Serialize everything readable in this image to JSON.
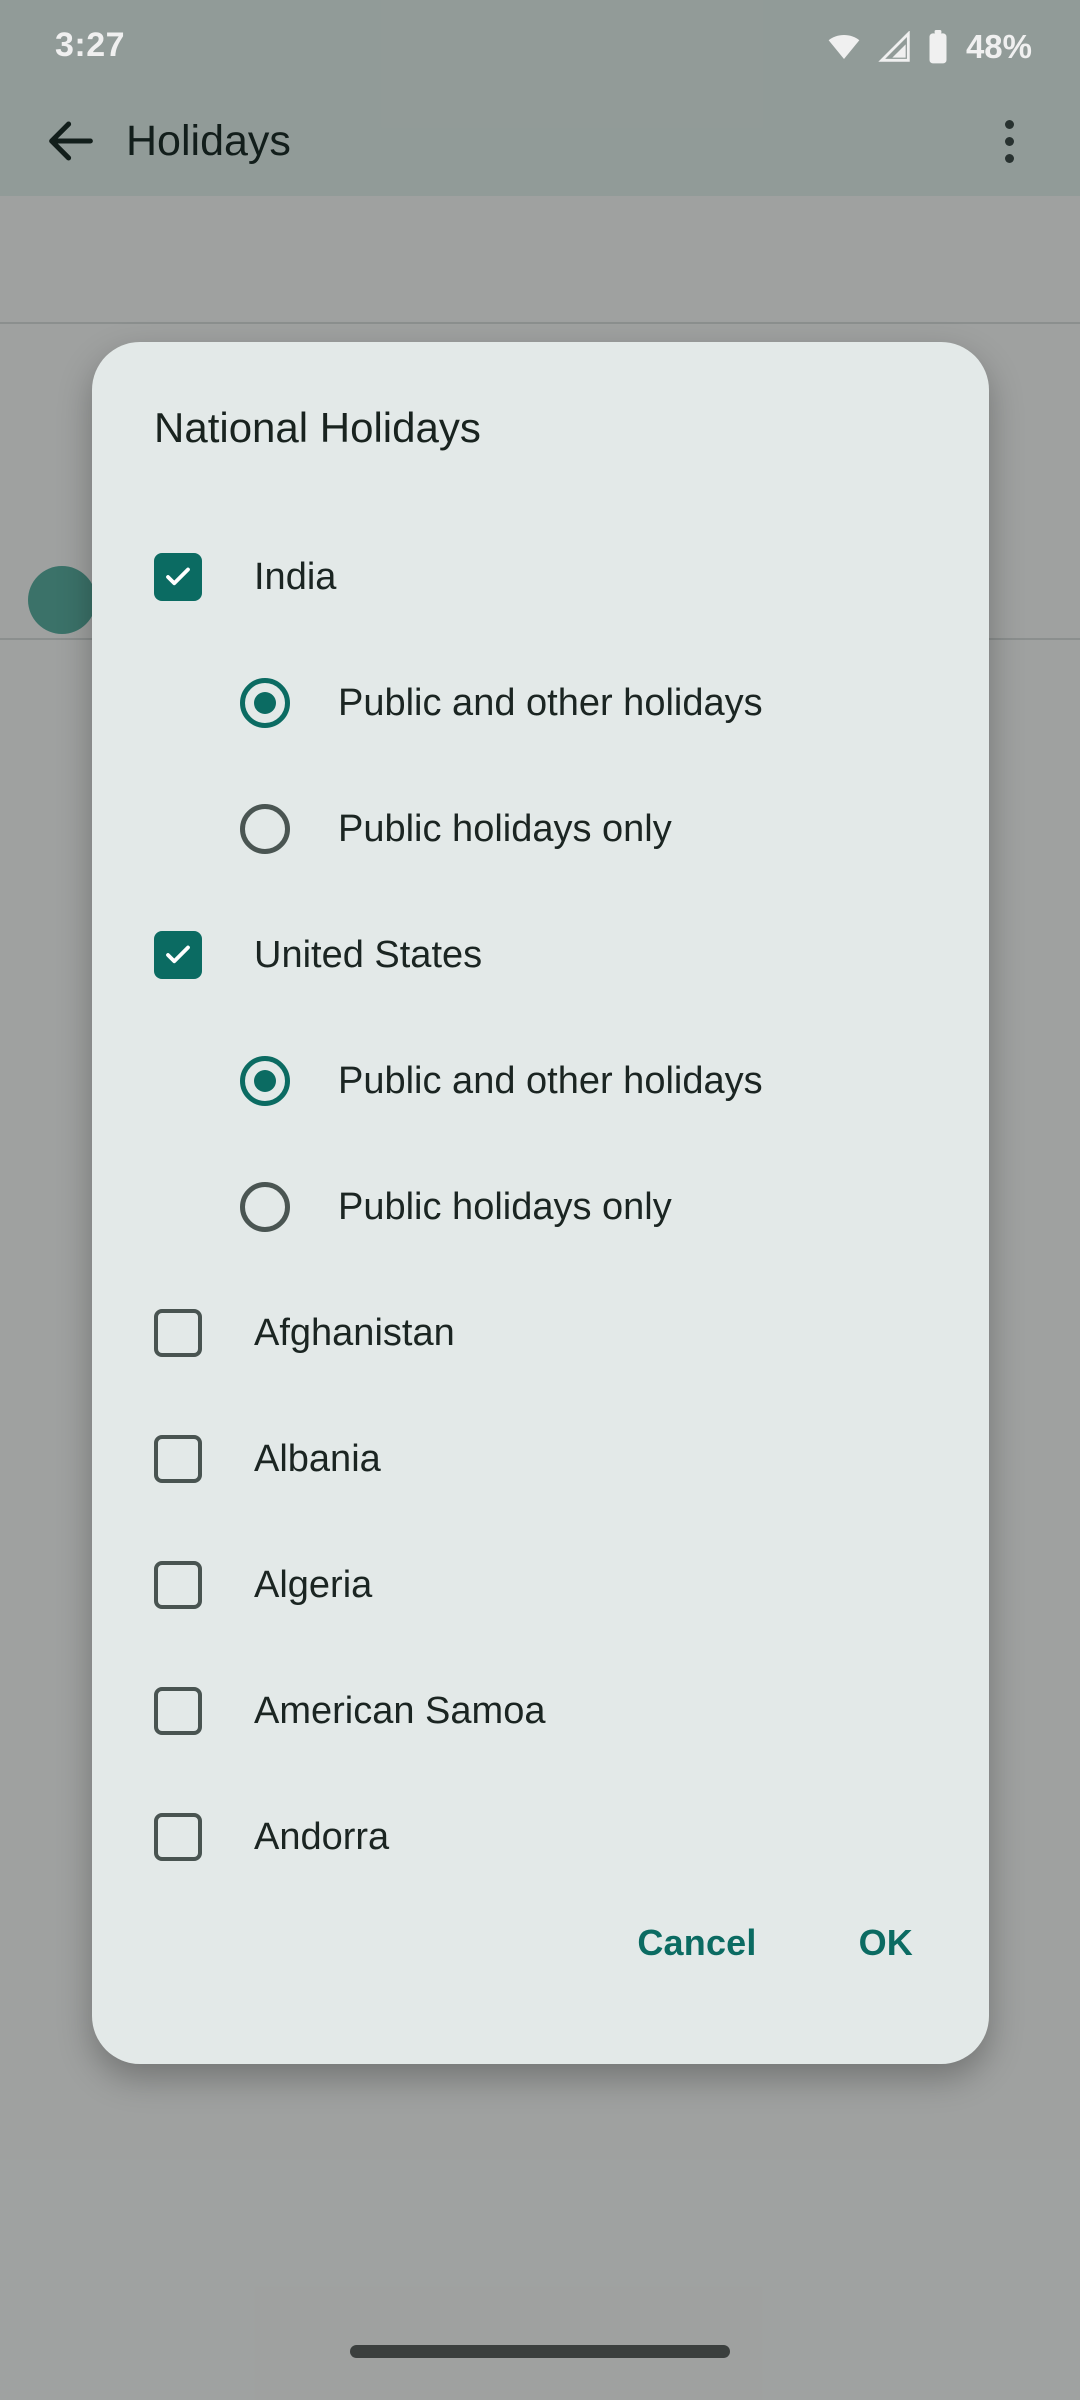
{
  "status_bar": {
    "time": "3:27",
    "battery_percent": "48%",
    "icons": [
      "wifi-icon",
      "cell-signal-icon",
      "battery-icon"
    ]
  },
  "app_bar": {
    "back_icon": "back-arrow-icon",
    "title": "Holidays",
    "overflow_icon": "overflow-menu-icon"
  },
  "dialog": {
    "title": "National Holidays",
    "rows": [
      {
        "kind": "checkbox",
        "label": "India",
        "checked": true
      },
      {
        "kind": "radio",
        "label": "Public and other holidays",
        "selected": true
      },
      {
        "kind": "radio",
        "label": "Public holidays only",
        "selected": false
      },
      {
        "kind": "checkbox",
        "label": "United States",
        "checked": true
      },
      {
        "kind": "radio",
        "label": "Public and other holidays",
        "selected": true
      },
      {
        "kind": "radio",
        "label": "Public holidays only",
        "selected": false
      },
      {
        "kind": "checkbox",
        "label": "Afghanistan",
        "checked": false
      },
      {
        "kind": "checkbox",
        "label": "Albania",
        "checked": false
      },
      {
        "kind": "checkbox",
        "label": "Algeria",
        "checked": false
      },
      {
        "kind": "checkbox",
        "label": "American Samoa",
        "checked": false
      },
      {
        "kind": "checkbox",
        "label": "Andorra",
        "checked": false
      }
    ],
    "cancel_label": "Cancel",
    "ok_label": "OK"
  },
  "colors": {
    "accent": "#0b6b62",
    "dialog_bg": "#e3e9e8",
    "scrim": "#a7aaa9",
    "appbar_bg": "#9ba5a2",
    "text": "#1b2522"
  },
  "nav_bar": {
    "handle": "gesture-handle"
  }
}
